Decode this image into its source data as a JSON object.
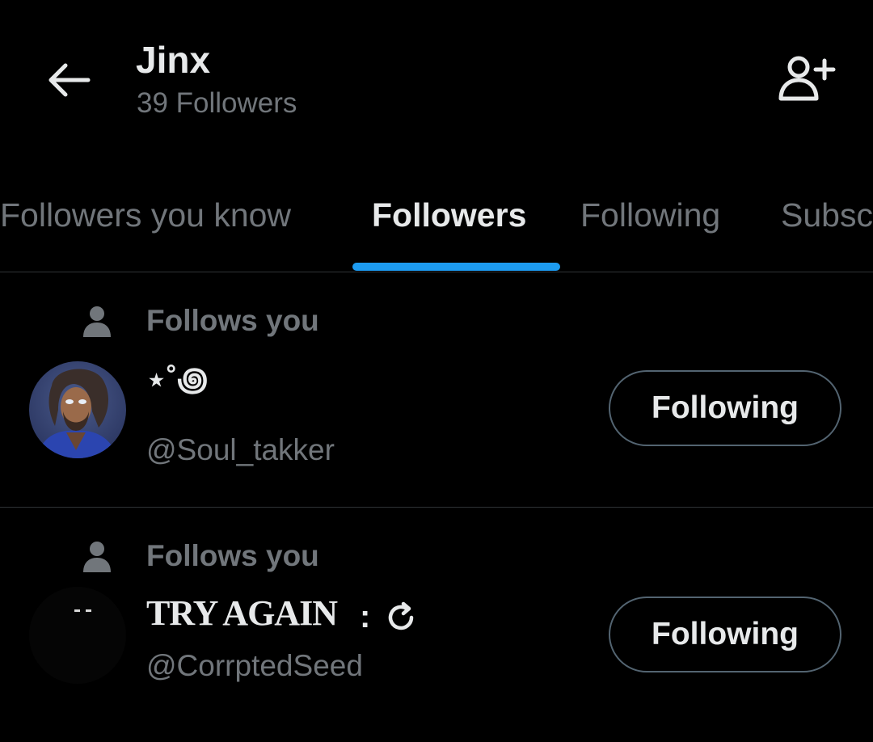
{
  "theme": {
    "background": "#000000",
    "text_primary": "#e7e9ea",
    "text_secondary": "#71767b",
    "accent": "#1d9bf0",
    "border": "#2f3336"
  },
  "header": {
    "back_icon": "arrow-left-icon",
    "title": "Jinx",
    "subtitle": "39 Followers",
    "add_user_icon": "person-plus-icon"
  },
  "tabs": [
    {
      "label": "Followers you know",
      "active": false
    },
    {
      "label": "Followers",
      "active": true
    },
    {
      "label": "Following",
      "active": false
    },
    {
      "label": "Subscriptions",
      "active": false
    }
  ],
  "users": [
    {
      "social_context": "Follows you",
      "social_icon": "person-icon",
      "display_name": "⋆˚꩜",
      "handle": "@Soul_takker",
      "button_label": "Following",
      "avatar_icon": "avatar-illustration"
    },
    {
      "social_context": "Follows you",
      "social_icon": "person-icon",
      "display_name": "TRY AGAIN",
      "name_suffix": ":",
      "name_icon": "refresh-icon",
      "handle": "@CorrptedSeed",
      "button_label": "Following",
      "avatar_icon": "dark-avatar"
    }
  ]
}
